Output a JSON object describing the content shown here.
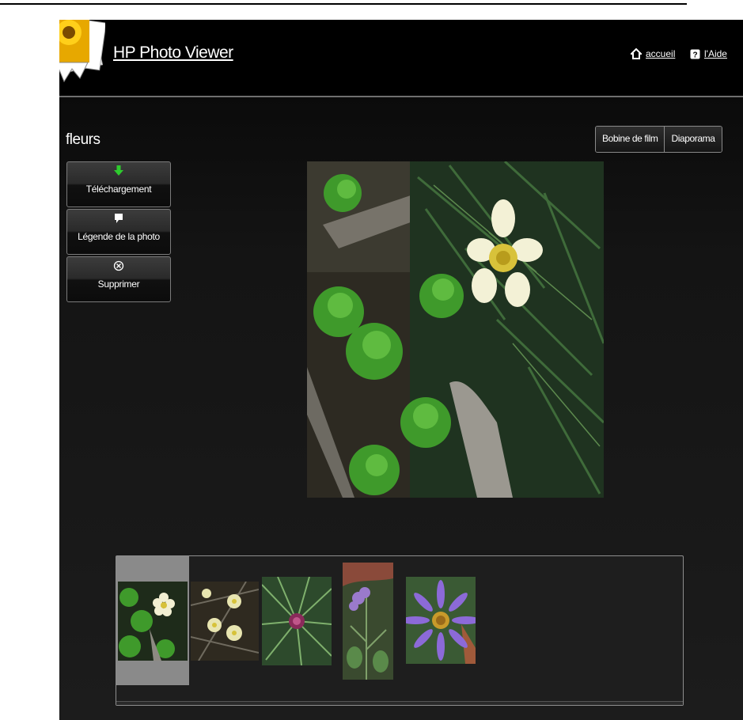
{
  "header": {
    "app_title": "HP Photo Viewer",
    "home_link": "accueil",
    "help_link": "l'Aide",
    "home_icon": "home-icon",
    "help_icon": "help-icon"
  },
  "album": {
    "title": "fleurs"
  },
  "view_toggle": {
    "filmstrip_label": "Bobine de film",
    "slideshow_label": "Diaporama"
  },
  "actions": [
    {
      "label": "Téléchargement",
      "icon": "download-arrow-icon",
      "color": "#2ecc2e"
    },
    {
      "label": "Légende de la photo",
      "icon": "caption-icon",
      "color": "#ffffff"
    },
    {
      "label": "Supprimer",
      "icon": "delete-x-icon",
      "color": "#ffffff"
    }
  ],
  "main_photo": {
    "subject": "white-yellow-flower"
  },
  "filmstrip": {
    "selected_index": 0,
    "thumbnails": [
      {
        "subject": "white-flower-with-leaves"
      },
      {
        "subject": "several-pale-yellow-flowers"
      },
      {
        "subject": "pink-thistle-in-pine"
      },
      {
        "subject": "purple-blossoms-on-stalk"
      },
      {
        "subject": "purple-aster"
      }
    ]
  },
  "colors": {
    "background": "#000000",
    "text": "#ffffff",
    "selection": "#8a8a8a",
    "download_accent": "#2ecc2e"
  }
}
